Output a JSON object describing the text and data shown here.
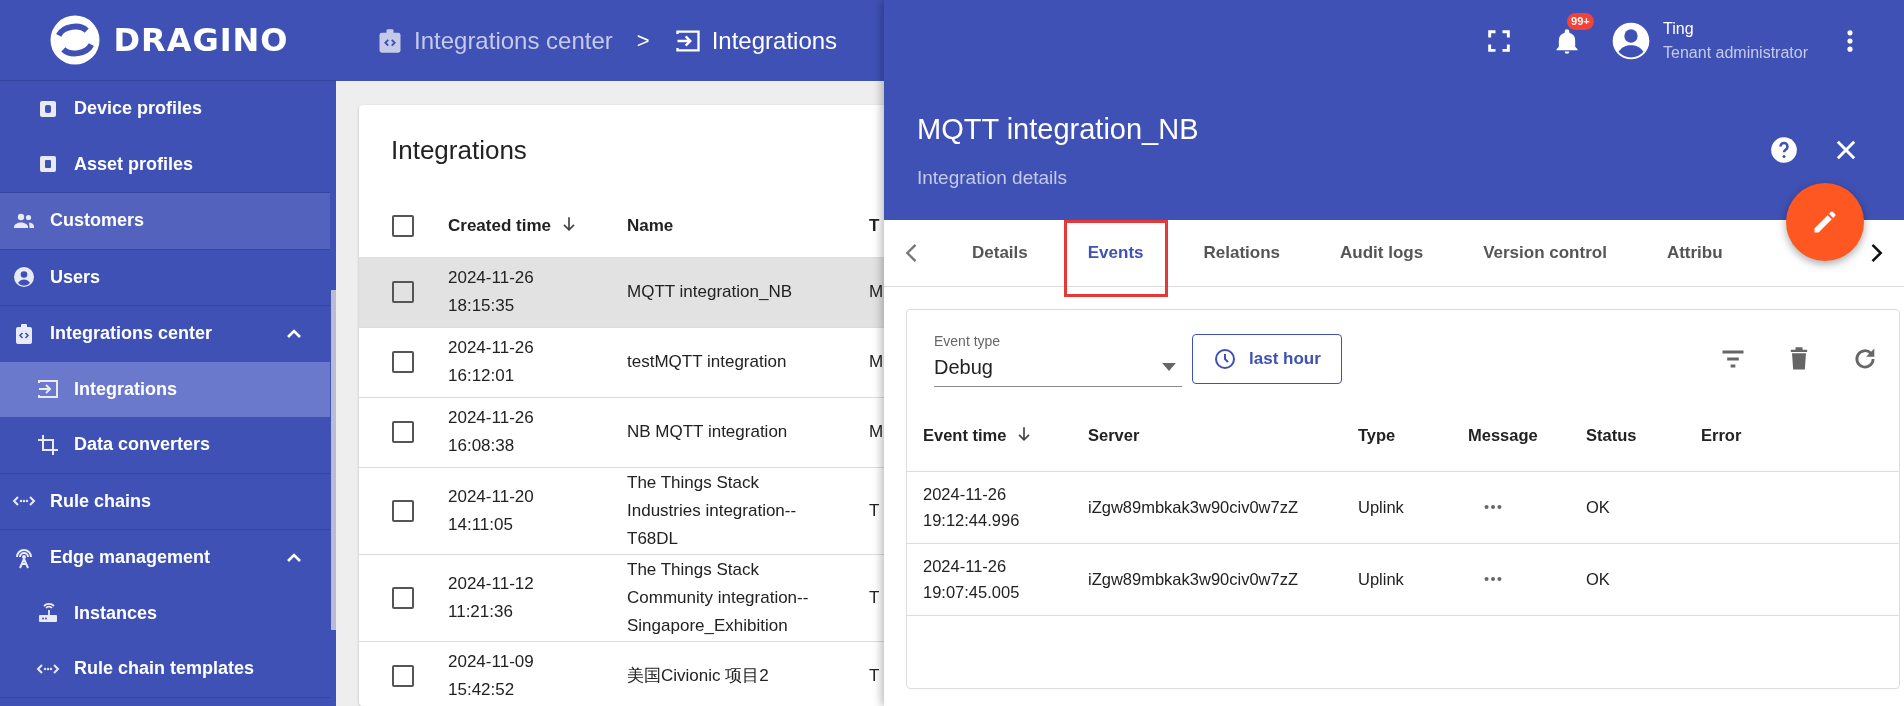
{
  "logo": {
    "text": "DRAGINO"
  },
  "sidebar": {
    "items": [
      {
        "children": [
          {
            "label": "Device profiles",
            "selected": false,
            "hovered": false
          },
          {
            "label": "Asset profiles",
            "selected": false,
            "hovered": false
          }
        ]
      },
      {
        "label": "Customers",
        "selected": false,
        "hovered": true
      },
      {
        "label": "Users",
        "selected": false,
        "hovered": false
      },
      {
        "label": "Integrations center",
        "selected": false,
        "hovered": false,
        "expanded": true,
        "children": [
          {
            "label": "Integrations",
            "selected": true,
            "hovered": false
          },
          {
            "label": "Data converters",
            "selected": false,
            "hovered": false
          }
        ]
      },
      {
        "label": "Rule chains",
        "selected": false,
        "hovered": false
      },
      {
        "label": "Edge management",
        "selected": false,
        "hovered": false,
        "expanded": true,
        "children": [
          {
            "label": "Instances",
            "selected": false,
            "hovered": false
          },
          {
            "label": "Rule chain templates",
            "selected": false,
            "hovered": false
          }
        ]
      }
    ]
  },
  "breadcrumb": {
    "items": [
      "Integrations center",
      "Integrations"
    ],
    "separator": ">"
  },
  "header": {
    "notifications_badge": "99+",
    "user": {
      "name": "Ting",
      "role": "Tenant administrator"
    }
  },
  "integrations": {
    "title": "Integrations",
    "all_checked": false,
    "columns": [
      {
        "label": "Created time",
        "sorted": true
      },
      {
        "label": "Name",
        "sorted": false
      },
      {
        "label": "T",
        "sorted": false
      }
    ],
    "rows": [
      {
        "created_time": "2024-11-26 18:15:35",
        "name": "MQTT integration_NB",
        "column_3": "M",
        "checked": false,
        "selected": true
      },
      {
        "created_time": "2024-11-26 16:12:01",
        "name": "testMQTT integration",
        "column_3": "M",
        "checked": false,
        "selected": false
      },
      {
        "created_time": "2024-11-26 16:08:38",
        "name": "NB MQTT integration",
        "column_3": "M",
        "checked": false,
        "selected": false
      },
      {
        "created_time": "2024-11-20 14:11:05",
        "name": "The Things Stack Industries integration-- T68DL",
        "column_3": "T",
        "checked": false,
        "selected": false
      },
      {
        "created_time": "2024-11-12 11:21:36",
        "name": "The Things Stack Community integration-- Singapore_Exhibition",
        "column_3": "T",
        "checked": false,
        "selected": false
      },
      {
        "created_time": "2024-11-09 15:42:52",
        "name": "美国Civionic 项目2",
        "column_3": "T",
        "checked": false,
        "selected": false
      }
    ]
  },
  "details": {
    "title": "MQTT integration_NB",
    "subtitle": "Integration details",
    "tabs": [
      {
        "label": "Details",
        "selected": false,
        "annotated": false
      },
      {
        "label": "Events",
        "selected": true,
        "annotated": true
      },
      {
        "label": "Relations",
        "selected": false,
        "annotated": false
      },
      {
        "label": "Audit logs",
        "selected": false,
        "annotated": false
      },
      {
        "label": "Version control",
        "selected": false,
        "annotated": false
      },
      {
        "label": "Attribu",
        "selected": false,
        "annotated": false
      }
    ],
    "event_type": {
      "label": "Event type",
      "value": "Debug"
    },
    "time_button": "last hour",
    "events": {
      "columns": [
        {
          "label": "Event time",
          "sorted": true
        },
        {
          "label": "Server",
          "sorted": false
        },
        {
          "label": "Type",
          "sorted": false
        },
        {
          "label": "Message",
          "sorted": false
        },
        {
          "label": "Status",
          "sorted": false
        },
        {
          "label": "Error",
          "sorted": false
        }
      ],
      "rows": [
        {
          "event_time": "2024-11-26 19:12:44.996",
          "server": "iZgw89mbkak3w90civ0w7zZ",
          "type": "Uplink",
          "status": "OK"
        },
        {
          "event_time": "2024-11-26 19:07:45.005",
          "server": "iZgw89mbkak3w90civ0w7zZ",
          "type": "Uplink",
          "status": "OK"
        }
      ]
    }
  }
}
